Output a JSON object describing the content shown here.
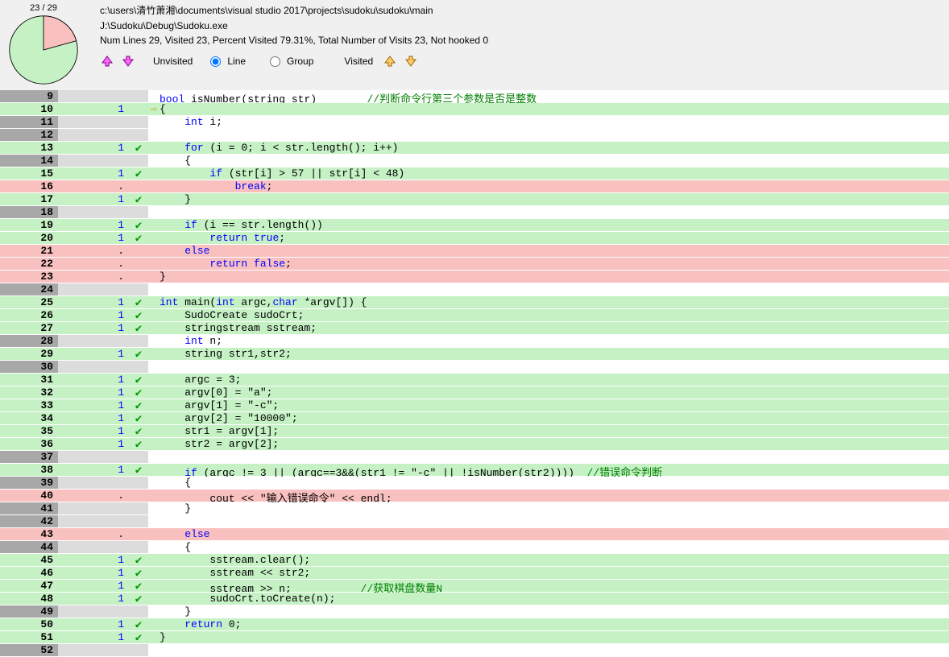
{
  "pie": {
    "label": "23 / 29",
    "visited": 23,
    "total": 29
  },
  "header": {
    "path1": "c:\\users\\清竹萧湘\\documents\\visual studio 2017\\projects\\sudoku\\sudoku\\main",
    "path2": "J:\\Sudoku\\Debug\\Sudoku.exe",
    "stats": "Num Lines    29, Visited    23, Percent Visited 79.31%, Total Number of Visits      23, Not hooked 0"
  },
  "toolbar": {
    "unvisited_label": "Unvisited",
    "line_label": "Line",
    "group_label": "Group",
    "visited_label": "Visited"
  },
  "rows": [
    {
      "n": 9,
      "bg": "gray",
      "vbg": "lightgray",
      "v": "",
      "chk": "",
      "arr": "",
      "cbg": "white",
      "tokens": [
        [
          "bool",
          "kw"
        ],
        [
          " isNumber(string str)        ",
          ""
        ],
        [
          "//判断命令行第三个参数是否是整数",
          "cmt"
        ]
      ]
    },
    {
      "n": 10,
      "bg": "visited",
      "vbg": "visited",
      "v": "1",
      "vs": "num",
      "chk": "",
      "arr": "⇨",
      "cbg": "visited",
      "tokens": [
        [
          "{",
          ""
        ]
      ]
    },
    {
      "n": 11,
      "bg": "gray",
      "vbg": "lightgray",
      "v": "",
      "chk": "",
      "arr": "",
      "cbg": "white",
      "tokens": [
        [
          "    ",
          ""
        ],
        [
          "int",
          "kw"
        ],
        [
          " i;",
          ""
        ]
      ]
    },
    {
      "n": 12,
      "bg": "gray",
      "vbg": "lightgray",
      "v": "",
      "chk": "",
      "arr": "",
      "cbg": "white",
      "tokens": [
        [
          "",
          ""
        ]
      ]
    },
    {
      "n": 13,
      "bg": "visited",
      "vbg": "visited",
      "v": "1",
      "vs": "num",
      "chk": "✔",
      "arr": "",
      "cbg": "visited",
      "tokens": [
        [
          "    ",
          ""
        ],
        [
          "for",
          "kw"
        ],
        [
          " (i = 0; i < str.length(); i++)",
          ""
        ]
      ]
    },
    {
      "n": 14,
      "bg": "gray",
      "vbg": "lightgray",
      "v": "",
      "chk": "",
      "arr": "",
      "cbg": "white",
      "tokens": [
        [
          "    {",
          ""
        ]
      ]
    },
    {
      "n": 15,
      "bg": "visited",
      "vbg": "visited",
      "v": "1",
      "vs": "num",
      "chk": "✔",
      "arr": "",
      "cbg": "visited",
      "tokens": [
        [
          "        ",
          ""
        ],
        [
          "if",
          "kw"
        ],
        [
          " (str[i] > 57 || str[i] < 48)",
          ""
        ]
      ]
    },
    {
      "n": 16,
      "bg": "notvisited",
      "vbg": "notvisited",
      "v": ".",
      "vs": "dot",
      "chk": "",
      "arr": "",
      "cbg": "notvisited",
      "tokens": [
        [
          "            ",
          ""
        ],
        [
          "break",
          "kw"
        ],
        [
          ";",
          ""
        ]
      ]
    },
    {
      "n": 17,
      "bg": "visited",
      "vbg": "visited",
      "v": "1",
      "vs": "num",
      "chk": "✔",
      "arr": "",
      "cbg": "visited",
      "tokens": [
        [
          "    }",
          ""
        ]
      ]
    },
    {
      "n": 18,
      "bg": "gray",
      "vbg": "lightgray",
      "v": "",
      "chk": "",
      "arr": "",
      "cbg": "white",
      "tokens": [
        [
          "",
          ""
        ]
      ]
    },
    {
      "n": 19,
      "bg": "visited",
      "vbg": "visited",
      "v": "1",
      "vs": "num",
      "chk": "✔",
      "arr": "",
      "cbg": "visited",
      "tokens": [
        [
          "    ",
          ""
        ],
        [
          "if",
          "kw"
        ],
        [
          " (i == str.length())",
          ""
        ]
      ]
    },
    {
      "n": 20,
      "bg": "visited",
      "vbg": "visited",
      "v": "1",
      "vs": "num",
      "chk": "✔",
      "arr": "",
      "cbg": "visited",
      "tokens": [
        [
          "        ",
          ""
        ],
        [
          "return",
          "kw"
        ],
        [
          " ",
          ""
        ],
        [
          "true",
          "kw"
        ],
        [
          ";",
          ""
        ]
      ]
    },
    {
      "n": 21,
      "bg": "notvisited",
      "vbg": "notvisited",
      "v": ".",
      "vs": "dot",
      "chk": "",
      "arr": "",
      "cbg": "notvisited",
      "tokens": [
        [
          "    ",
          ""
        ],
        [
          "else",
          "kw"
        ]
      ]
    },
    {
      "n": 22,
      "bg": "notvisited",
      "vbg": "notvisited",
      "v": ".",
      "vs": "dot",
      "chk": "",
      "arr": "",
      "cbg": "notvisited",
      "tokens": [
        [
          "        ",
          ""
        ],
        [
          "return",
          "kw"
        ],
        [
          " ",
          ""
        ],
        [
          "false",
          "kw"
        ],
        [
          ";",
          ""
        ]
      ]
    },
    {
      "n": 23,
      "bg": "notvisited",
      "vbg": "notvisited",
      "v": ".",
      "vs": "dot",
      "chk": "",
      "arr": "",
      "cbg": "notvisited",
      "tokens": [
        [
          "}",
          ""
        ]
      ]
    },
    {
      "n": 24,
      "bg": "gray",
      "vbg": "lightgray",
      "v": "",
      "chk": "",
      "arr": "",
      "cbg": "white",
      "tokens": [
        [
          "",
          ""
        ]
      ]
    },
    {
      "n": 25,
      "bg": "visited",
      "vbg": "visited",
      "v": "1",
      "vs": "num",
      "chk": "✔",
      "arr": "",
      "cbg": "visited",
      "tokens": [
        [
          "int",
          "kw"
        ],
        [
          " main(",
          ""
        ],
        [
          "int",
          "kw"
        ],
        [
          " argc,",
          ""
        ],
        [
          "char",
          "kw"
        ],
        [
          " *argv[]) {",
          ""
        ]
      ]
    },
    {
      "n": 26,
      "bg": "visited",
      "vbg": "visited",
      "v": "1",
      "vs": "num",
      "chk": "✔",
      "arr": "",
      "cbg": "visited",
      "tokens": [
        [
          "    SudoCreate sudoCrt;",
          ""
        ]
      ]
    },
    {
      "n": 27,
      "bg": "visited",
      "vbg": "visited",
      "v": "1",
      "vs": "num",
      "chk": "✔",
      "arr": "",
      "cbg": "visited",
      "tokens": [
        [
          "    stringstream sstream;",
          ""
        ]
      ]
    },
    {
      "n": 28,
      "bg": "gray",
      "vbg": "lightgray",
      "v": "",
      "chk": "",
      "arr": "",
      "cbg": "white",
      "tokens": [
        [
          "    ",
          ""
        ],
        [
          "int",
          "kw"
        ],
        [
          " n;",
          ""
        ]
      ]
    },
    {
      "n": 29,
      "bg": "visited",
      "vbg": "visited",
      "v": "1",
      "vs": "num",
      "chk": "✔",
      "arr": "",
      "cbg": "visited",
      "tokens": [
        [
          "    string str1,str2;",
          ""
        ]
      ]
    },
    {
      "n": 30,
      "bg": "gray",
      "vbg": "lightgray",
      "v": "",
      "chk": "",
      "arr": "",
      "cbg": "white",
      "tokens": [
        [
          "",
          ""
        ]
      ]
    },
    {
      "n": 31,
      "bg": "visited",
      "vbg": "visited",
      "v": "1",
      "vs": "num",
      "chk": "✔",
      "arr": "",
      "cbg": "visited",
      "tokens": [
        [
          "    argc = 3;",
          ""
        ]
      ]
    },
    {
      "n": 32,
      "bg": "visited",
      "vbg": "visited",
      "v": "1",
      "vs": "num",
      "chk": "✔",
      "arr": "",
      "cbg": "visited",
      "tokens": [
        [
          "    argv[0] = \"a\";",
          ""
        ]
      ]
    },
    {
      "n": 33,
      "bg": "visited",
      "vbg": "visited",
      "v": "1",
      "vs": "num",
      "chk": "✔",
      "arr": "",
      "cbg": "visited",
      "tokens": [
        [
          "    argv[1] = \"-c\";",
          ""
        ]
      ]
    },
    {
      "n": 34,
      "bg": "visited",
      "vbg": "visited",
      "v": "1",
      "vs": "num",
      "chk": "✔",
      "arr": "",
      "cbg": "visited",
      "tokens": [
        [
          "    argv[2] = \"10000\";",
          ""
        ]
      ]
    },
    {
      "n": 35,
      "bg": "visited",
      "vbg": "visited",
      "v": "1",
      "vs": "num",
      "chk": "✔",
      "arr": "",
      "cbg": "visited",
      "tokens": [
        [
          "    str1 = argv[1];",
          ""
        ]
      ]
    },
    {
      "n": 36,
      "bg": "visited",
      "vbg": "visited",
      "v": "1",
      "vs": "num",
      "chk": "✔",
      "arr": "",
      "cbg": "visited",
      "tokens": [
        [
          "    str2 = argv[2];",
          ""
        ]
      ]
    },
    {
      "n": 37,
      "bg": "gray",
      "vbg": "lightgray",
      "v": "",
      "chk": "",
      "arr": "",
      "cbg": "white",
      "tokens": [
        [
          "",
          ""
        ]
      ]
    },
    {
      "n": 38,
      "bg": "visited",
      "vbg": "visited",
      "v": "1",
      "vs": "num",
      "chk": "✔",
      "arr": "",
      "cbg": "visited",
      "tokens": [
        [
          "    ",
          ""
        ],
        [
          "if",
          "kw"
        ],
        [
          " (argc != 3 || (argc==3&&(str1 != \"-c\" || !isNumber(str2))))  ",
          ""
        ],
        [
          "//错误命令判断",
          "cmt"
        ]
      ]
    },
    {
      "n": 39,
      "bg": "gray",
      "vbg": "lightgray",
      "v": "",
      "chk": "",
      "arr": "",
      "cbg": "white",
      "tokens": [
        [
          "    {",
          ""
        ]
      ]
    },
    {
      "n": 40,
      "bg": "notvisited",
      "vbg": "notvisited",
      "v": ".",
      "vs": "dot",
      "chk": "",
      "arr": "",
      "cbg": "notvisited",
      "tokens": [
        [
          "        cout << \"输入错误命令\" << endl;",
          ""
        ]
      ]
    },
    {
      "n": 41,
      "bg": "gray",
      "vbg": "lightgray",
      "v": "",
      "chk": "",
      "arr": "",
      "cbg": "white",
      "tokens": [
        [
          "    }",
          ""
        ]
      ]
    },
    {
      "n": 42,
      "bg": "gray",
      "vbg": "lightgray",
      "v": "",
      "chk": "",
      "arr": "",
      "cbg": "white",
      "tokens": [
        [
          "",
          ""
        ]
      ]
    },
    {
      "n": 43,
      "bg": "notvisited",
      "vbg": "notvisited",
      "v": ".",
      "vs": "dot",
      "chk": "",
      "arr": "",
      "cbg": "notvisited",
      "tokens": [
        [
          "    ",
          ""
        ],
        [
          "else",
          "kw"
        ]
      ]
    },
    {
      "n": 44,
      "bg": "gray",
      "vbg": "lightgray",
      "v": "",
      "chk": "",
      "arr": "",
      "cbg": "white",
      "tokens": [
        [
          "    {",
          ""
        ]
      ]
    },
    {
      "n": 45,
      "bg": "visited",
      "vbg": "visited",
      "v": "1",
      "vs": "num",
      "chk": "✔",
      "arr": "",
      "cbg": "visited",
      "tokens": [
        [
          "        sstream.clear();",
          ""
        ]
      ]
    },
    {
      "n": 46,
      "bg": "visited",
      "vbg": "visited",
      "v": "1",
      "vs": "num",
      "chk": "✔",
      "arr": "",
      "cbg": "visited",
      "tokens": [
        [
          "        sstream << str2;",
          ""
        ]
      ]
    },
    {
      "n": 47,
      "bg": "visited",
      "vbg": "visited",
      "v": "1",
      "vs": "num",
      "chk": "✔",
      "arr": "",
      "cbg": "visited",
      "tokens": [
        [
          "        sstream >> n;           ",
          ""
        ],
        [
          "//获取棋盘数量N",
          "cmt"
        ]
      ]
    },
    {
      "n": 48,
      "bg": "visited",
      "vbg": "visited",
      "v": "1",
      "vs": "num",
      "chk": "✔",
      "arr": "",
      "cbg": "visited",
      "tokens": [
        [
          "        sudoCrt.toCreate(n);",
          ""
        ]
      ]
    },
    {
      "n": 49,
      "bg": "gray",
      "vbg": "lightgray",
      "v": "",
      "chk": "",
      "arr": "",
      "cbg": "white",
      "tokens": [
        [
          "    }",
          ""
        ]
      ]
    },
    {
      "n": 50,
      "bg": "visited",
      "vbg": "visited",
      "v": "1",
      "vs": "num",
      "chk": "✔",
      "arr": "",
      "cbg": "visited",
      "tokens": [
        [
          "    ",
          ""
        ],
        [
          "return",
          "kw"
        ],
        [
          " 0;",
          ""
        ]
      ]
    },
    {
      "n": 51,
      "bg": "visited",
      "vbg": "visited",
      "v": "1",
      "vs": "num",
      "chk": "✔",
      "arr": "",
      "cbg": "visited",
      "tokens": [
        [
          "}",
          ""
        ]
      ]
    },
    {
      "n": 52,
      "bg": "gray",
      "vbg": "lightgray",
      "v": "",
      "chk": "",
      "arr": "",
      "cbg": "white",
      "tokens": [
        [
          "",
          ""
        ]
      ]
    }
  ],
  "chart_data": {
    "type": "pie",
    "categories": [
      "Visited",
      "Not visited"
    ],
    "values": [
      23,
      6
    ],
    "title": "23 / 29",
    "colors": [
      "#c5f1c5",
      "#f9c0c0"
    ]
  }
}
